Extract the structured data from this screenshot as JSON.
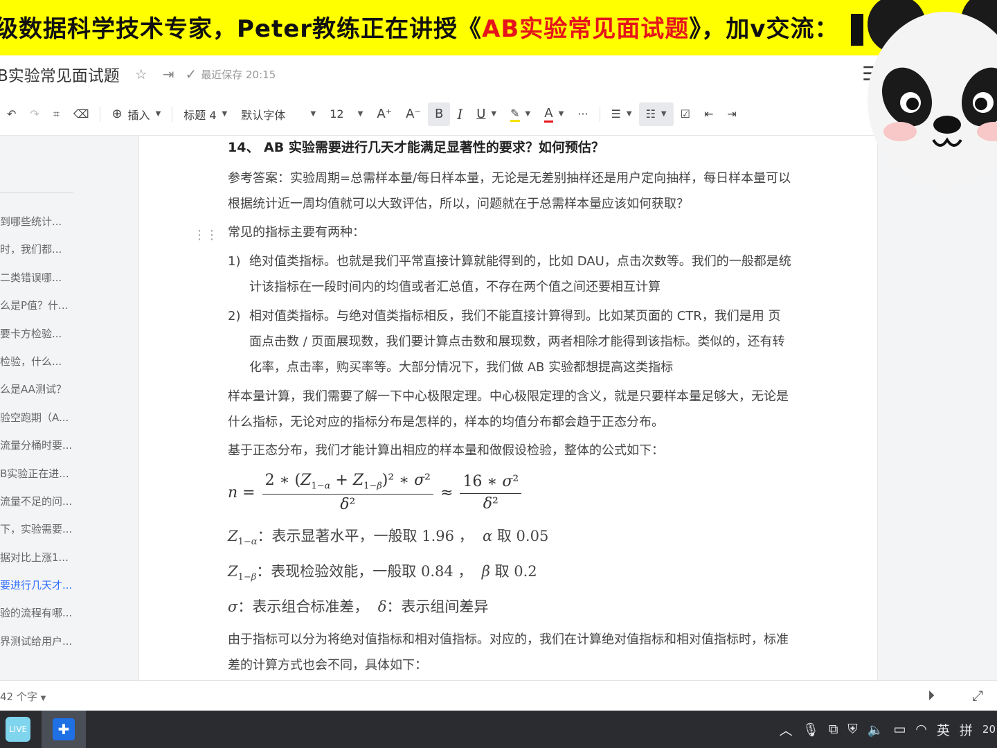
{
  "banner": {
    "prefix": "级数据科学技术专家，Peter教练正在讲授《",
    "highlight": "AB实验常见面试题",
    "suffix": "》，加v交流："
  },
  "titlebar": {
    "doc_title": "B实验常见面试题",
    "save_status": "最近保存 20:15"
  },
  "toolbar": {
    "insert_label": "插入",
    "heading_label": "标题 4",
    "font_label": "默认字体",
    "size_label": "12",
    "bold": "B",
    "italic": "I",
    "underline": "U",
    "font_color": "A",
    "more": "···"
  },
  "sidebar": {
    "items": [
      "到哪些统计...",
      "时，我们都...",
      "二类错误哪...",
      "么是P值？什...",
      "要卡方检验...",
      "检验，什么...",
      "么是AA测试？",
      "验空跑期（A...",
      "流量分桶时要...",
      "B实验正在进...",
      "流量不足的问...",
      "下，实验需要...",
      "据对比上涨1...",
      "要进行几天才...",
      "验的流程有哪...",
      "界测试给用户..."
    ],
    "current_index": 13
  },
  "doc": {
    "heading": "14、 AB 实验需要进行几天才能满足显著性的要求？如何预估？",
    "p1": "参考答案：实验周期=总需样本量/每日样本量，无论是无差别抽样还是用户定向抽样，每日样本量可以根据统计近一周均值就可以大致评估，所以，问题就在于总需样本量应该如何获取？",
    "p2": "常见的指标主要有两种：",
    "li1_num": "1)",
    "li1": "绝对值类指标。也就是我们平常直接计算就能得到的，比如 DAU，点击次数等。我们的一般都是统计该指标在一段时间内的均值或者汇总值，不存在两个值之间还要相互计算",
    "li2_num": "2)",
    "li2": "相对值类指标。与绝对值类指标相反，我们不能直接计算得到。比如某页面的 CTR，我们是用 页面点击数 / 页面展现数，我们要计算点击数和展现数，两者相除才能得到该指标。类似的，还有转化率，点击率，购买率等。大部分情况下，我们做 AB 实验都想提高这类指标",
    "p3": "样本量计算，我们需要了解一下中心极限定理。中心极限定理的含义，就是只要样本量足够大，无论是什么指标，无论对应的指标分布是怎样的，样本的均值分布都会趋于正态分布。",
    "p4": "基于正态分布，我们才能计算出相应的样本量和做假设检验，整体的公式如下：",
    "m1_text": "：表示显著水平，一般取 1.96 ，",
    "m1_tail": " 取 0.05",
    "m2_text": "：表现检验效能，一般取 0.84 ，",
    "m2_tail": " 取 0.2",
    "m3_a": "：表示组合标准差，",
    "m3_b": "：表示组间差异",
    "p5": "由于指标可以分为将绝对值指标和相对值指标。对应的，我们在计算绝对值指标和相对值指标时，标准差的计算方式也会不同，具体如下："
  },
  "statusbar": {
    "word_count": "42 个字"
  },
  "taskbar": {
    "app1": "LIVE",
    "ime_lang": "英",
    "ime_mode": "拼",
    "clock": "20"
  }
}
